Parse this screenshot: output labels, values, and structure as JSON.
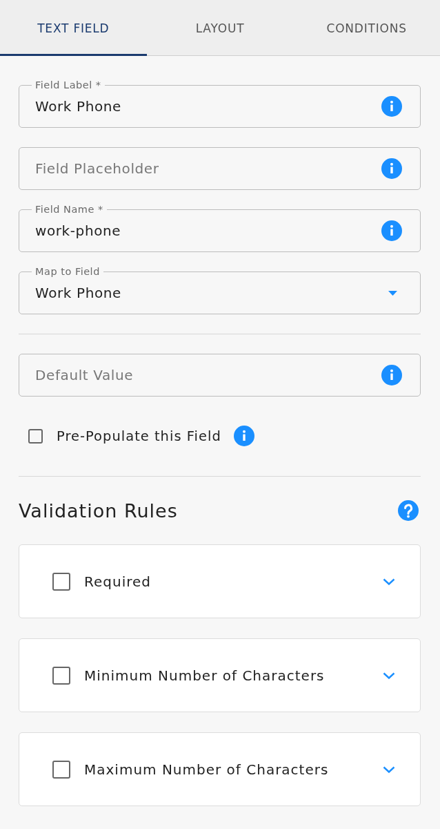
{
  "tabs": [
    {
      "label": "TEXT FIELD",
      "selected": true
    },
    {
      "label": "LAYOUT",
      "selected": false
    },
    {
      "label": "CONDITIONS",
      "selected": false
    }
  ],
  "fields": [
    {
      "kind": "text",
      "label": "Field Label *",
      "value": "Work Phone"
    },
    {
      "kind": "text",
      "placeholder": "Field Placeholder"
    },
    {
      "kind": "text",
      "label": "Field Name *",
      "value": "work-phone"
    },
    {
      "kind": "select",
      "label": "Map to Field",
      "value": "Work Phone"
    }
  ],
  "default_field": {
    "kind": "text",
    "placeholder": "Default Value"
  },
  "prepopulate": {
    "label": "Pre-Populate this Field",
    "checked": false
  },
  "validation": {
    "title": "Validation Rules",
    "rules": [
      {
        "label": "Required",
        "checked": false,
        "expanded": false
      },
      {
        "label": "Minimum Number of Characters",
        "checked": false,
        "expanded": false
      },
      {
        "label": "Maximum Number of Characters",
        "checked": false,
        "expanded": false
      }
    ]
  }
}
